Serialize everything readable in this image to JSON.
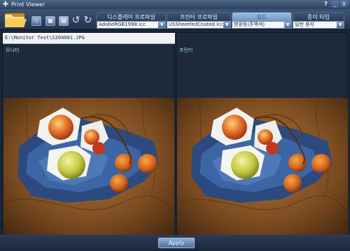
{
  "window": {
    "title": "Print Viewer",
    "help_label": "?",
    "minimize_label": "_",
    "close_label": "x"
  },
  "toolbar": {
    "tabs": [
      {
        "label": "디스플레이 프로파일",
        "active": false
      },
      {
        "label": "프린터 프로파일",
        "active": false
      },
      {
        "label": "모드",
        "active": true
      },
      {
        "label": "종이 타입",
        "active": false
      }
    ],
    "combos": [
      {
        "value": "AdobeRGB1998.icc"
      },
      {
        "value": "USSheetfedCoated.icc"
      },
      {
        "value": "향광등(주백색)"
      },
      {
        "value": "일반 용지"
      }
    ],
    "icons": [
      "folder-open-icon",
      "compare-icon",
      "grid-icon",
      "document-icon",
      "undo-icon",
      "redo-icon"
    ]
  },
  "panels": {
    "path": "E:\\Monitor Test\\S204001.JPG",
    "left_label": "모니터",
    "right_label": "프린터"
  },
  "footer": {
    "apply_label": "Apply"
  },
  "colors": {
    "accent": "#6d95c0",
    "background": "#1b2636",
    "panel": "#1e2a3b"
  }
}
